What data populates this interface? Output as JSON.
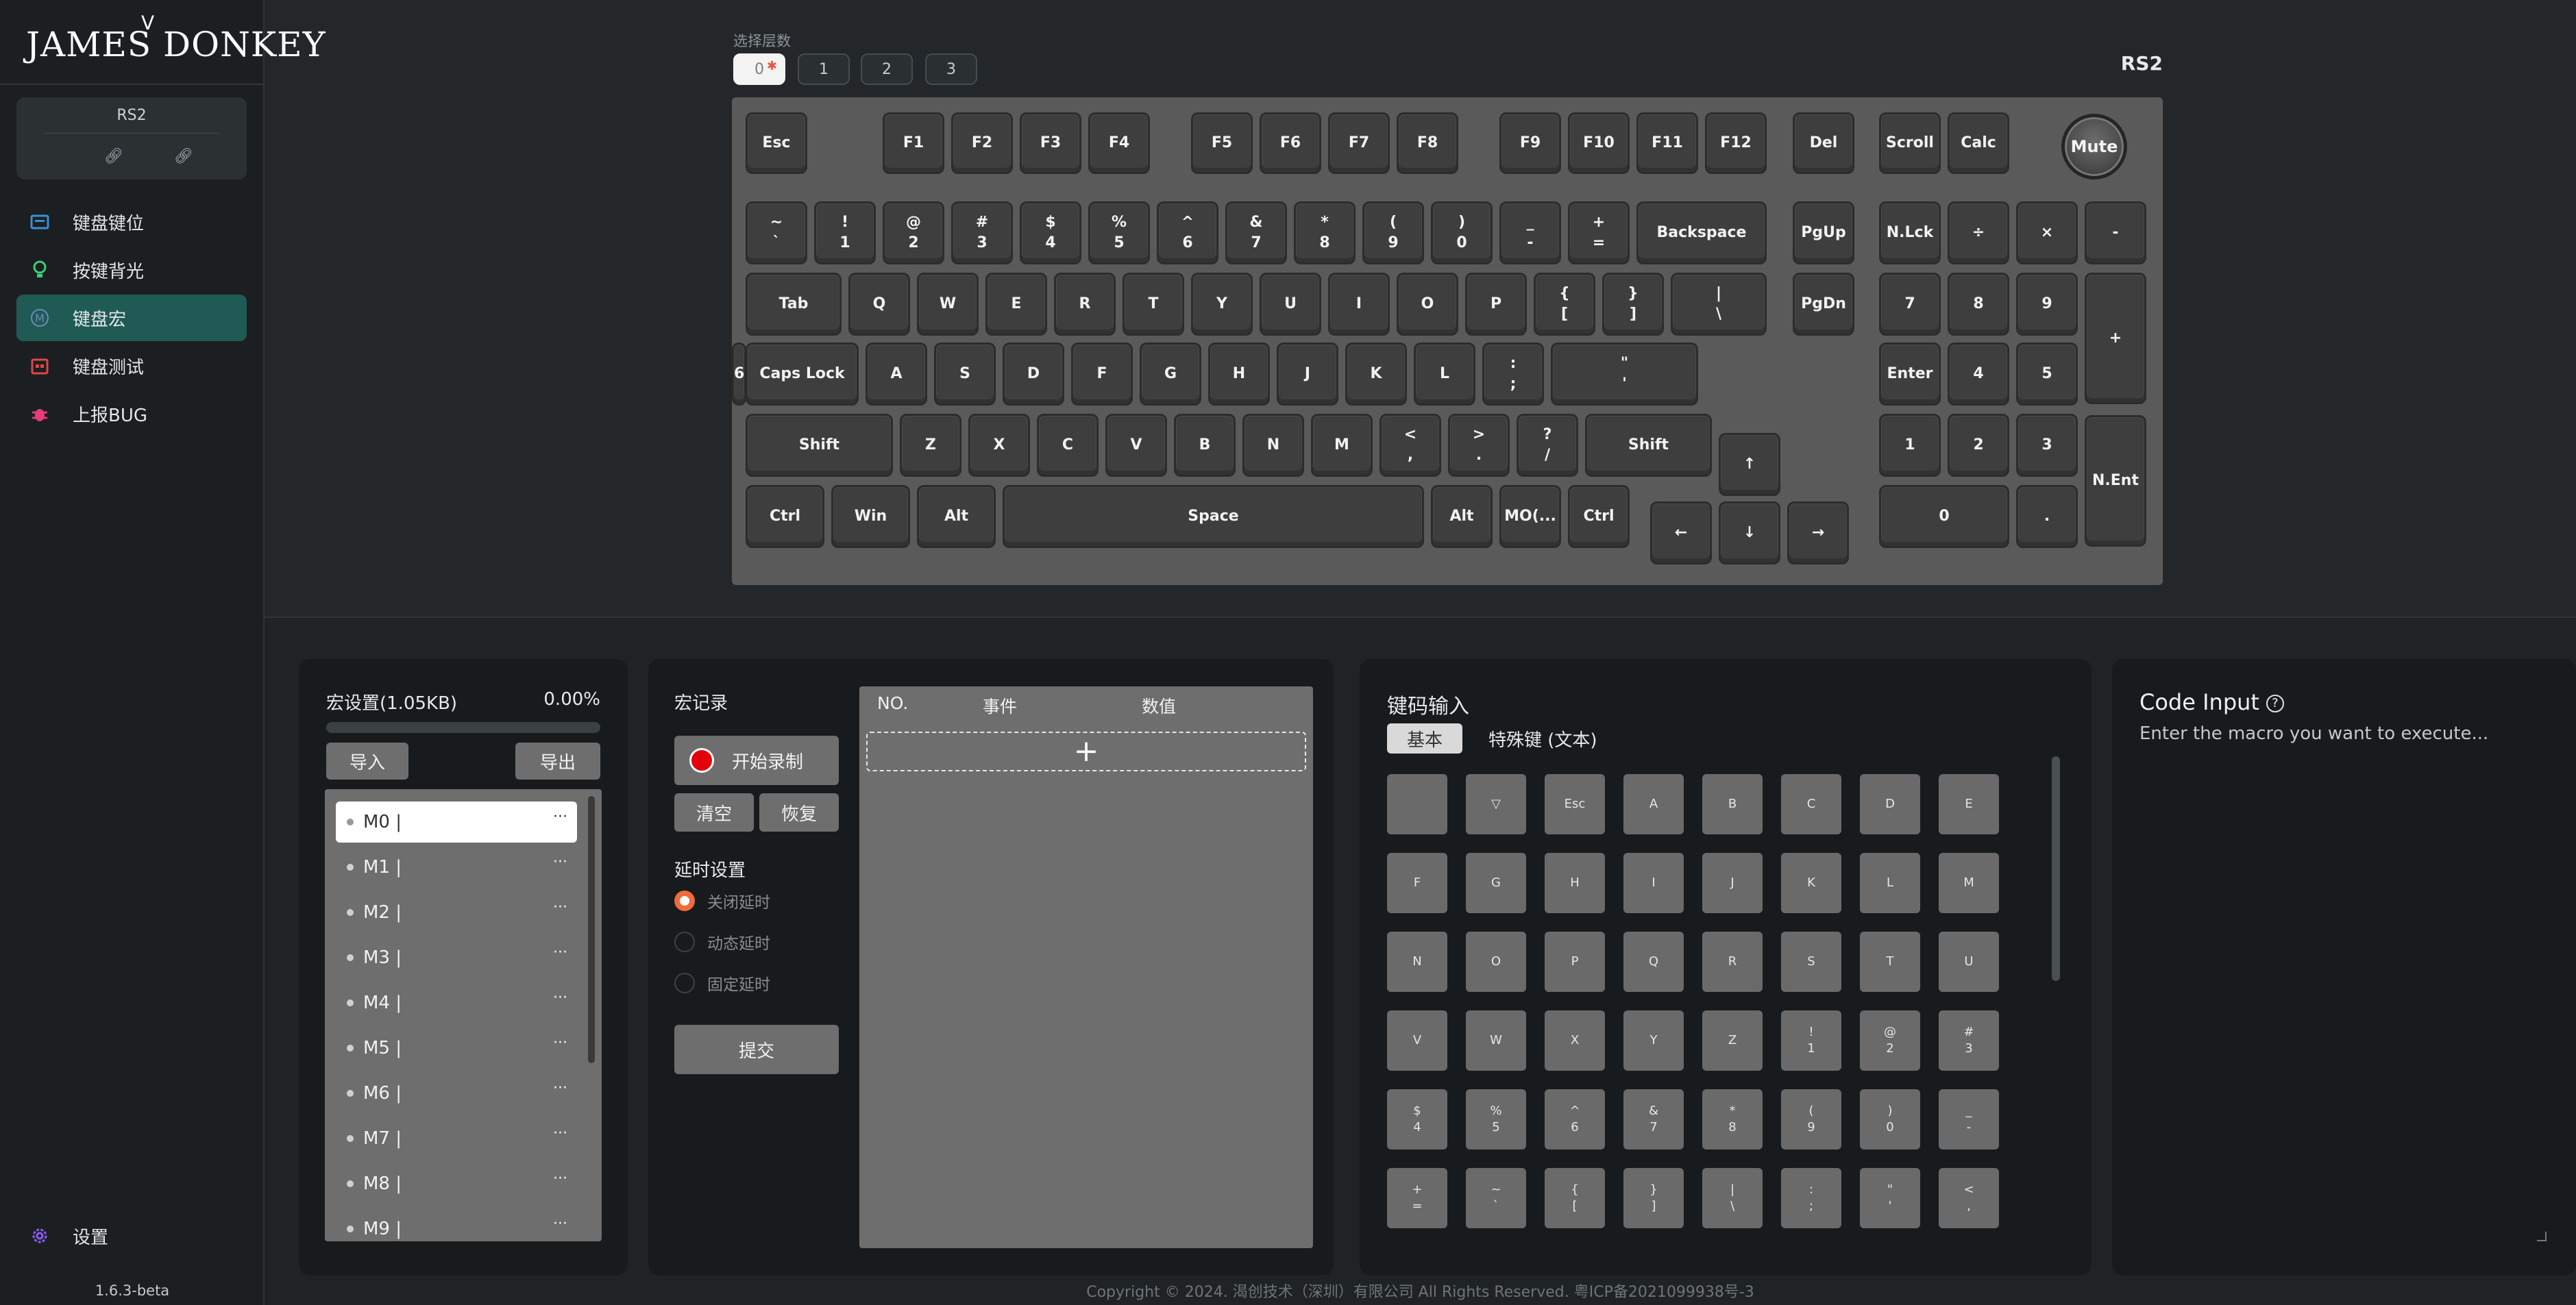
{
  "sidebar": {
    "logo": "JAMES DONKEY",
    "device": "RS2",
    "nav": [
      {
        "label": "键盘键位",
        "icon": "keyboard-icon",
        "color": "#3a8fd8"
      },
      {
        "label": "按键背光",
        "icon": "bulb-icon",
        "color": "#3ccf78"
      },
      {
        "label": "键盘宏",
        "icon": "macro-m-icon",
        "color": "#6f8bb3",
        "active": true
      },
      {
        "label": "键盘测试",
        "icon": "test-icon",
        "color": "#e04646"
      },
      {
        "label": "上报BUG",
        "icon": "bug-icon",
        "color": "#e43d7a"
      }
    ],
    "settings_label": "设置",
    "settings_color": "#8a5cf6",
    "version": "1.6.3-beta"
  },
  "layers": {
    "title": "选择层数",
    "items": [
      "0",
      "1",
      "2",
      "3"
    ],
    "active": "0"
  },
  "device_title": "RS2",
  "keyboard": {
    "row_f": [
      "Esc",
      "F1",
      "F2",
      "F3",
      "F4",
      "F5",
      "F6",
      "F7",
      "F8",
      "F9",
      "F10",
      "F11",
      "F12",
      "Del",
      "Scroll",
      "Calc"
    ],
    "knob": "Mute",
    "row_num": [
      "~\n`",
      "!\n1",
      "@\n2",
      "#\n3",
      "$\n4",
      "%\n5",
      "^\n6",
      "&\n7",
      "*\n8",
      "(\n9",
      ")\n0",
      "_\n-",
      "+\n=",
      "Backspace",
      "PgUp",
      "N.Lck",
      "÷",
      "×",
      "-"
    ],
    "row_tab": [
      "Tab",
      "Q",
      "W",
      "E",
      "R",
      "T",
      "Y",
      "U",
      "I",
      "O",
      "P",
      "{\n[",
      "}\n]",
      "|\n\\",
      "PgDn",
      "7",
      "8",
      "9",
      "+"
    ],
    "row_caps": [
      "Caps Lock",
      "A",
      "S",
      "D",
      "F",
      "G",
      "H",
      "J",
      "K",
      "L",
      ":\n;",
      "\"\n'",
      "Enter",
      "4",
      "5",
      "6"
    ],
    "row_shift": [
      "Shift",
      "Z",
      "X",
      "C",
      "V",
      "B",
      "N",
      "M",
      "<\n,",
      ">\n.",
      "?\n/",
      "Shift",
      "↑",
      "1",
      "2",
      "3",
      "N.Ent"
    ],
    "row_ctrl": [
      "Ctrl",
      "Win",
      "Alt",
      "Space",
      "Alt",
      "MO(...",
      "Ctrl",
      "←",
      "↓",
      "→",
      "0",
      "."
    ]
  },
  "macro_settings": {
    "title": "宏设置(1.05KB)",
    "percent": "0.00%",
    "progress": 0.0,
    "import_label": "导入",
    "export_label": "导出",
    "items": [
      "M0 |",
      "M1 |",
      "M2 |",
      "M3 |",
      "M4 |",
      "M5 |",
      "M6 |",
      "M7 |",
      "M8 |",
      "M9 |"
    ],
    "more": "···"
  },
  "macro_record": {
    "title": "宏记录",
    "start_label": "开始录制",
    "clear_label": "清空",
    "restore_label": "恢复",
    "delay_title": "延时设置",
    "delay_options": [
      "关闭延时",
      "动态延时",
      "固定延时"
    ],
    "delay_selected": 0,
    "submit_label": "提交",
    "table_headers": [
      "NO.",
      "事件",
      "数值"
    ],
    "add_symbol": "+"
  },
  "keycode": {
    "title": "键码输入",
    "tabs": [
      "基本",
      "特殊键 (文本)"
    ],
    "grid": [
      "",
      "▽",
      "Esc",
      "A",
      "B",
      "C",
      "D",
      "E",
      "F",
      "G",
      "H",
      "I",
      "J",
      "K",
      "L",
      "M",
      "N",
      "O",
      "P",
      "Q",
      "R",
      "S",
      "T",
      "U",
      "V",
      "W",
      "X",
      "Y",
      "Z",
      "!\n1",
      "@\n2",
      "#\n3",
      "$\n4",
      "%\n5",
      "^\n6",
      "&\n7",
      "*\n8",
      "(\n9",
      ")\n0",
      "_\n-",
      "+\n=",
      "~\n`",
      "{\n[",
      "}\n]",
      "|\n\\",
      ":\n;",
      "\"\n'",
      "<\n,"
    ]
  },
  "code_input": {
    "title": "Code Input",
    "help": "?",
    "placeholder": "Enter the macro you want to execute..."
  },
  "footer": "Copyright © 2024. 渴创技术（深圳）有限公司 All Rights Reserved. 粤ICP备2021099938号-3"
}
